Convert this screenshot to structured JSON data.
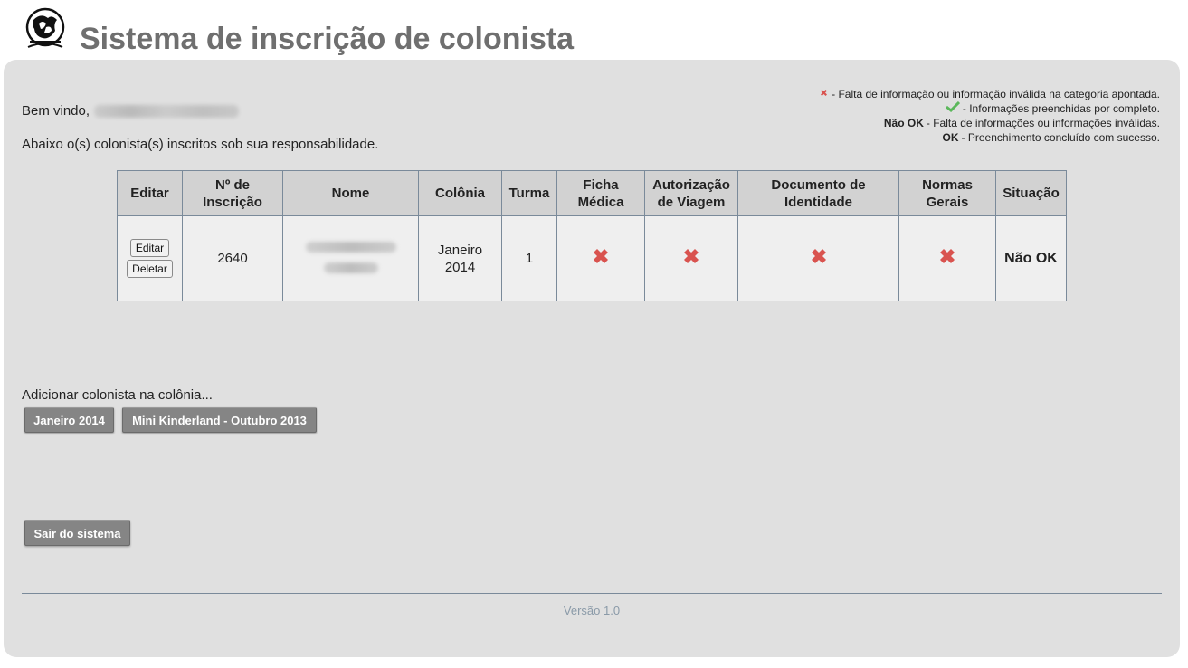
{
  "header": {
    "title": "Sistema de inscrição de colonista"
  },
  "legend": {
    "invalid_text": "- Falta de informação ou informação inválida na categoria apontada.",
    "complete_text": "- Informações preenchidas por completo.",
    "not_ok_label": "Não OK",
    "not_ok_text": " - Falta de informações ou informações inválidas.",
    "ok_label": "OK",
    "ok_text": " - Preenchimento concluído com sucesso."
  },
  "welcome": {
    "greeting": "Bem vindo,",
    "subline": "Abaixo o(s) colonista(s) inscritos sob sua responsabilidade."
  },
  "table": {
    "headers": {
      "edit": "Editar",
      "reg_no_1": "Nº de",
      "reg_no_2": "Inscrição",
      "name": "Nome",
      "colony": "Colônia",
      "class": "Turma",
      "medical_1": "Ficha",
      "medical_2": "Médica",
      "travel_1": "Autorização",
      "travel_2": "de Viagem",
      "id_doc_1": "Documento de",
      "id_doc_2": "Identidade",
      "rules_1": "Normas",
      "rules_2": "Gerais",
      "status": "Situação"
    },
    "rows": [
      {
        "edit_label": "Editar",
        "delete_label": "Deletar",
        "reg_no": "2640",
        "colony_1": "Janeiro",
        "colony_2": "2014",
        "class": "1",
        "status": "Não OK"
      }
    ]
  },
  "add": {
    "label": "Adicionar colonista na colônia...",
    "button_1": "Janeiro 2014",
    "button_2": "Mini Kinderland - Outubro 2013"
  },
  "logout_label": "Sair do sistema",
  "version": "Versão 1.0",
  "colors": {
    "panel": "#e0e0e0",
    "title": "#6f6f6f",
    "x_mark": "#d9534f",
    "check": "#5cb85c",
    "button": "#858585"
  }
}
